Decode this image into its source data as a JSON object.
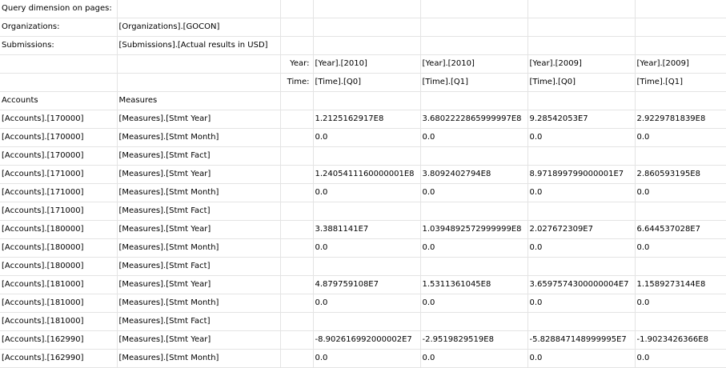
{
  "header": {
    "query_label": "Query dimension on pages:",
    "org_label": "Organizations:",
    "org_value": "[Organizations].[GOCON]",
    "sub_label": "Submissions:",
    "sub_value": "[Submissions].[Actual results in USD]",
    "year_label": "Year:",
    "time_label": "Time:",
    "columns": [
      {
        "year": "[Year].[2010]",
        "time": "[Time].[Q0]"
      },
      {
        "year": "[Year].[2010]",
        "time": "[Time].[Q1]"
      },
      {
        "year": "[Year].[2009]",
        "time": "[Time].[Q0]"
      },
      {
        "year": "[Year].[2009]",
        "time": "[Time].[Q1]"
      }
    ],
    "accounts_label": "Accounts",
    "measures_label": "Measures"
  },
  "rows": [
    {
      "account": "[Accounts].[170000]",
      "measure": "[Measures].[Stmt Year]",
      "values": [
        "1.2125162917E8",
        "3.6802222865999997E8",
        "9.28542053E7",
        "2.9229781839E8"
      ]
    },
    {
      "account": "[Accounts].[170000]",
      "measure": "[Measures].[Stmt Month]",
      "values": [
        "0.0",
        "0.0",
        "0.0",
        "0.0"
      ]
    },
    {
      "account": "[Accounts].[170000]",
      "measure": "[Measures].[Stmt Fact]",
      "values": [
        "",
        "",
        "",
        ""
      ]
    },
    {
      "account": "[Accounts].[171000]",
      "measure": "[Measures].[Stmt Year]",
      "values": [
        "1.2405411160000001E8",
        "3.8092402794E8",
        "8.971899799000001E7",
        "2.860593195E8"
      ]
    },
    {
      "account": "[Accounts].[171000]",
      "measure": "[Measures].[Stmt Month]",
      "values": [
        "0.0",
        "0.0",
        "0.0",
        "0.0"
      ]
    },
    {
      "account": "[Accounts].[171000]",
      "measure": "[Measures].[Stmt Fact]",
      "values": [
        "",
        "",
        "",
        ""
      ]
    },
    {
      "account": "[Accounts].[180000]",
      "measure": "[Measures].[Stmt Year]",
      "values": [
        "3.3881141E7",
        "1.0394892572999999E8",
        "2.027672309E7",
        "6.644537028E7"
      ]
    },
    {
      "account": "[Accounts].[180000]",
      "measure": "[Measures].[Stmt Month]",
      "values": [
        "0.0",
        "0.0",
        "0.0",
        "0.0"
      ]
    },
    {
      "account": "[Accounts].[180000]",
      "measure": "[Measures].[Stmt Fact]",
      "values": [
        "",
        "",
        "",
        ""
      ]
    },
    {
      "account": "[Accounts].[181000]",
      "measure": "[Measures].[Stmt Year]",
      "values": [
        "4.879759108E7",
        "1.5311361045E8",
        "3.6597574300000004E7",
        "1.1589273144E8"
      ]
    },
    {
      "account": "[Accounts].[181000]",
      "measure": "[Measures].[Stmt Month]",
      "values": [
        "0.0",
        "0.0",
        "0.0",
        "0.0"
      ]
    },
    {
      "account": "[Accounts].[181000]",
      "measure": "[Measures].[Stmt Fact]",
      "values": [
        "",
        "",
        "",
        ""
      ]
    },
    {
      "account": "[Accounts].[162990]",
      "measure": "[Measures].[Stmt Year]",
      "values": [
        "-8.902616992000002E7",
        "-2.9519829519E8",
        "-5.828847148999995E7",
        "-1.9023426366E8"
      ]
    },
    {
      "account": "[Accounts].[162990]",
      "measure": "[Measures].[Stmt Month]",
      "values": [
        "0.0",
        "0.0",
        "0.0",
        "0.0"
      ]
    }
  ]
}
